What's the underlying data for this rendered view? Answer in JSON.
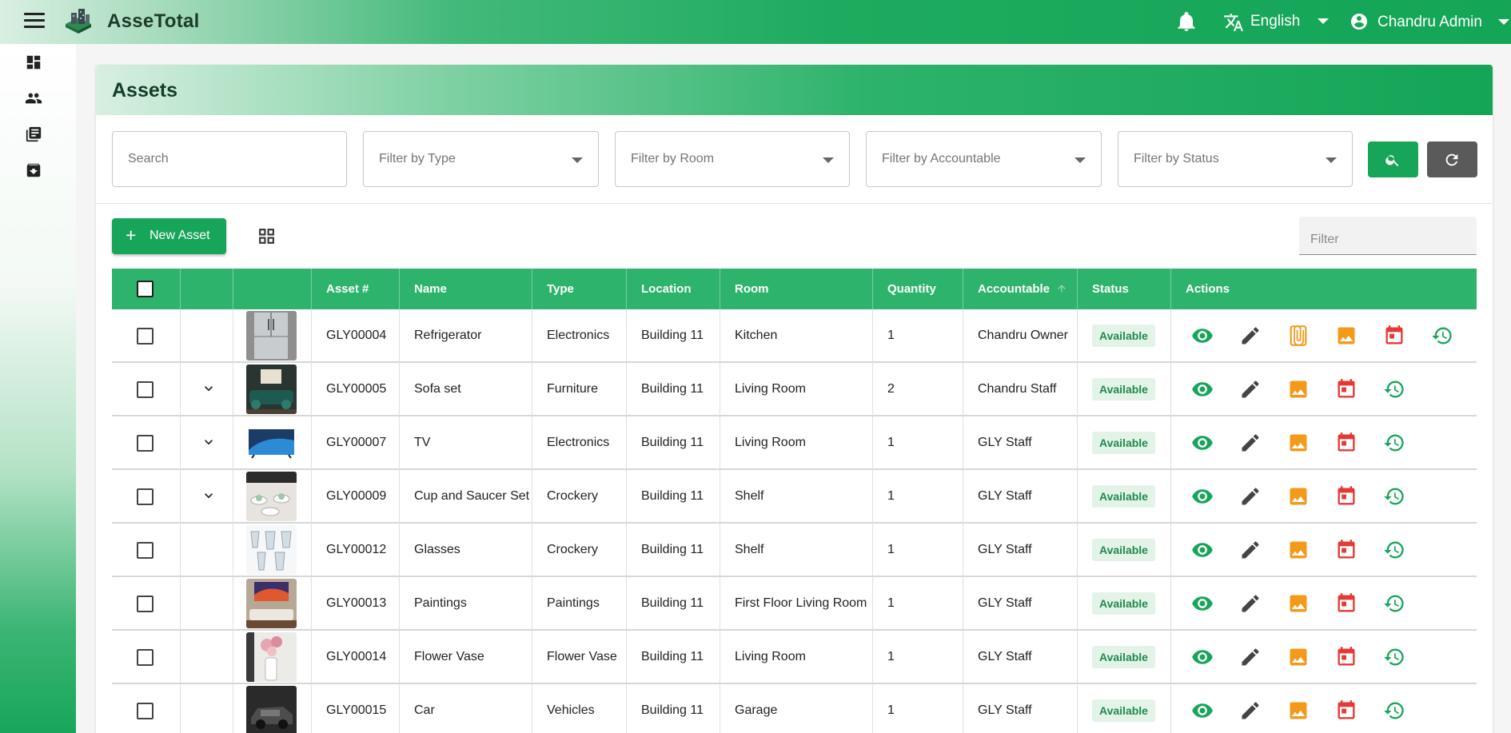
{
  "app": {
    "title": "AsseTotal"
  },
  "topbar": {
    "language": "English",
    "user": "Chandru Admin"
  },
  "sidebar": {
    "items": [
      "dashboard-icon",
      "people-icon",
      "library-books-icon",
      "archive-icon"
    ]
  },
  "page": {
    "title": "Assets"
  },
  "filters": {
    "search_placeholder": "Search",
    "type_placeholder": "Filter by Type",
    "room_placeholder": "Filter by Room",
    "accountable_placeholder": "Filter by Accountable",
    "status_placeholder": "Filter by Status"
  },
  "toolbar": {
    "new_label": "New Asset",
    "filter_placeholder": "Filter"
  },
  "table": {
    "headers": {
      "asset": "Asset #",
      "name": "Name",
      "type": "Type",
      "location": "Location",
      "room": "Room",
      "quantity": "Quantity",
      "accountable": "Accountable",
      "status": "Status",
      "actions": "Actions"
    },
    "rows": [
      {
        "asset": "GLY00004",
        "name": "Refrigerator",
        "type": "Electronics",
        "location": "Building 11",
        "room": "Kitchen",
        "quantity": "1",
        "accountable": "Chandru Owner",
        "status": "Available",
        "expandable": false,
        "attachment": true,
        "thumb": "fridge"
      },
      {
        "asset": "GLY00005",
        "name": "Sofa set",
        "type": "Furniture",
        "location": "Building 11",
        "room": "Living Room",
        "quantity": "2",
        "accountable": "Chandru Staff",
        "status": "Available",
        "expandable": true,
        "attachment": false,
        "thumb": "sofa"
      },
      {
        "asset": "GLY00007",
        "name": "TV",
        "type": "Electronics",
        "location": "Building 11",
        "room": "Living Room",
        "quantity": "1",
        "accountable": "GLY Staff",
        "status": "Available",
        "expandable": true,
        "attachment": false,
        "thumb": "tv"
      },
      {
        "asset": "GLY00009",
        "name": "Cup and Saucer Set",
        "type": "Crockery",
        "location": "Building 11",
        "room": "Shelf",
        "quantity": "1",
        "accountable": "GLY Staff",
        "status": "Available",
        "expandable": true,
        "attachment": false,
        "thumb": "cups"
      },
      {
        "asset": "GLY00012",
        "name": "Glasses",
        "type": "Crockery",
        "location": "Building 11",
        "room": "Shelf",
        "quantity": "1",
        "accountable": "GLY Staff",
        "status": "Available",
        "expandable": false,
        "attachment": false,
        "thumb": "glasses"
      },
      {
        "asset": "GLY00013",
        "name": "Paintings",
        "type": "Paintings",
        "location": "Building 11",
        "room": "First Floor Living Room",
        "quantity": "1",
        "accountable": "GLY Staff",
        "status": "Available",
        "expandable": false,
        "attachment": false,
        "thumb": "painting"
      },
      {
        "asset": "GLY00014",
        "name": "Flower Vase",
        "type": "Flower Vase",
        "location": "Building 11",
        "room": "Living Room",
        "quantity": "1",
        "accountable": "GLY Staff",
        "status": "Available",
        "expandable": false,
        "attachment": false,
        "thumb": "vase"
      },
      {
        "asset": "GLY00015",
        "name": "Car",
        "type": "Vehicles",
        "location": "Building 11",
        "room": "Garage",
        "quantity": "1",
        "accountable": "GLY Staff",
        "status": "Available",
        "expandable": false,
        "attachment": false,
        "thumb": "car"
      }
    ]
  },
  "colors": {
    "primary": "#17a55a",
    "header": "#2eb36c",
    "orange": "#f39a1b",
    "red": "#e53935",
    "status_bg": "#e3f3e8"
  }
}
